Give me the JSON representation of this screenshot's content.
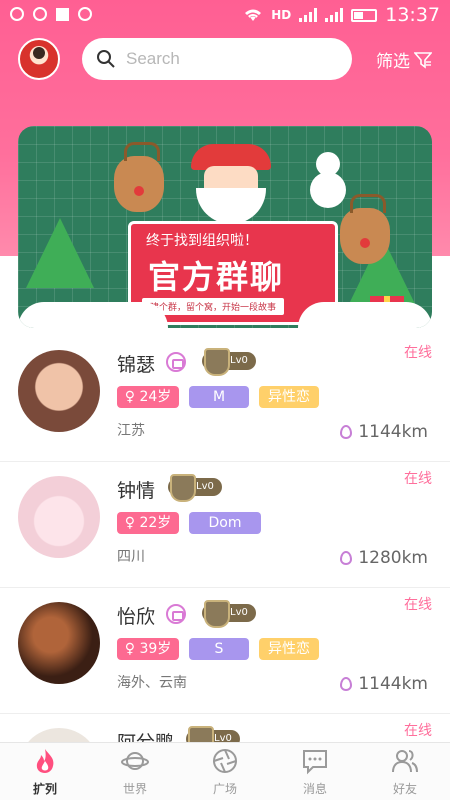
{
  "status_bar": {
    "network": "HD",
    "time": "13:37"
  },
  "header": {
    "search_placeholder": "Search",
    "filter_label": "筛选"
  },
  "banner": {
    "subtitle": "终于找到组织啦！",
    "title": "官方群聊",
    "strip": "建个群，留个窝，开始一段故事"
  },
  "users": [
    {
      "name": "锦瑟",
      "vip": true,
      "level": "Lv0",
      "status": "在线",
      "age": "♀ 24岁",
      "role": "M",
      "orientation": "异性恋",
      "location": "江苏",
      "distance": "1144km",
      "avatar_colors": [
        "#7a4a3a",
        "#d9a07a"
      ]
    },
    {
      "name": "钟情",
      "vip": false,
      "level": "Lv0",
      "status": "在线",
      "age": "♀ 22岁",
      "role": "Dom",
      "orientation": "",
      "location": "四川",
      "distance": "1280km",
      "avatar_colors": [
        "#f6d8df",
        "#fbe9ee"
      ]
    },
    {
      "name": "怡欣",
      "vip": true,
      "level": "Lv0",
      "status": "在线",
      "age": "♀ 39岁",
      "role": "S",
      "orientation": "异性恋",
      "location": "海外、云南",
      "distance": "1144km",
      "avatar_colors": [
        "#3b1f14",
        "#b0643a"
      ]
    },
    {
      "name": "阿兮鹏",
      "vip": false,
      "level": "Lv0",
      "status": "在线",
      "age": "",
      "role": "",
      "orientation": "",
      "location": "",
      "distance": "",
      "avatar_colors": [
        "#ece6df",
        "#c9bfb5"
      ]
    }
  ],
  "tabs": [
    {
      "label": "扩列",
      "icon": "flame-icon",
      "active": true
    },
    {
      "label": "世界",
      "icon": "planet-icon",
      "active": false
    },
    {
      "label": "广场",
      "icon": "aperture-icon",
      "active": false
    },
    {
      "label": "消息",
      "icon": "chat-bubble-icon",
      "active": false
    },
    {
      "label": "好友",
      "icon": "friends-icon",
      "active": false
    }
  ],
  "colors": {
    "brand": "#ff6f9c",
    "online": "#ff6f9c",
    "tag_age": "#fd6a91",
    "tag_role": "#a896ee",
    "tag_orientation": "#ffd06a"
  }
}
